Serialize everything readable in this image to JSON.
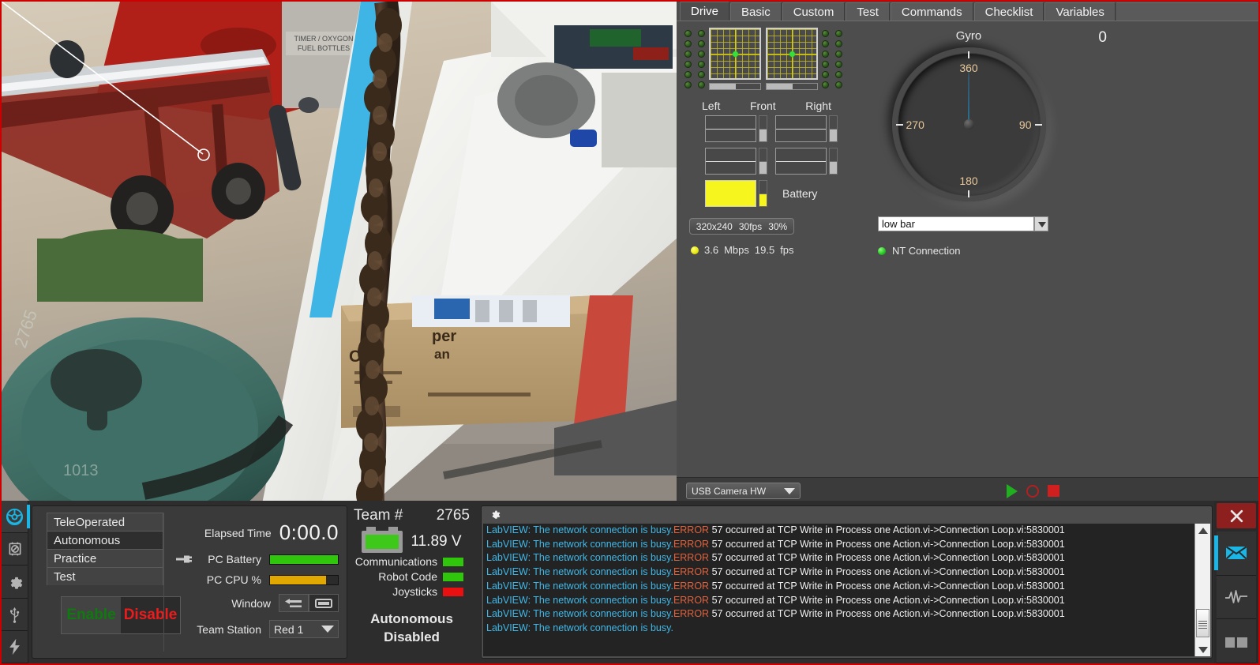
{
  "tabs": [
    {
      "label": "Drive",
      "active": true
    },
    {
      "label": "Basic",
      "active": false
    },
    {
      "label": "Custom",
      "active": false
    },
    {
      "label": "Test",
      "active": false
    },
    {
      "label": "Commands",
      "active": false
    },
    {
      "label": "Checklist",
      "active": false
    },
    {
      "label": "Variables",
      "active": false
    }
  ],
  "joystick": {
    "axis_labels": {
      "left": "Left",
      "front": "Front",
      "right": "Right"
    },
    "battery_label": "Battery"
  },
  "camera_info": {
    "resolution": "320x240",
    "fps": "30fps",
    "quality": "30%"
  },
  "stream_stats": {
    "bandwidth": "3.6",
    "bandwidth_unit": "Mbps",
    "fps": "19.5",
    "fps_unit": "fps"
  },
  "gyro": {
    "title": "Gyro",
    "value": "0",
    "ticks": [
      "360",
      "90",
      "180",
      "270"
    ],
    "needle_deg": 0,
    "needle_color": "#1f93d4"
  },
  "nt": {
    "field_value": "low bar",
    "status_label": "NT Connection"
  },
  "camera_source": {
    "label": "USB Camera HW"
  },
  "recorder": {
    "play": "play-icon",
    "record": "record-icon",
    "stop": "stop-icon"
  },
  "sidebar_left": [
    {
      "name": "operation-icon",
      "active": true
    },
    {
      "name": "diagnostics-icon",
      "active": false
    },
    {
      "name": "setup-gear-icon",
      "active": false
    },
    {
      "name": "usb-devices-icon",
      "active": false
    },
    {
      "name": "power-icon",
      "active": false
    }
  ],
  "sidebar_right": [
    {
      "name": "messages-icon",
      "active": true
    },
    {
      "name": "charts-icon",
      "active": false
    },
    {
      "name": "layout-icon",
      "active": false
    }
  ],
  "close_button": "close-icon",
  "control": {
    "modes": [
      {
        "label": "TeleOperated",
        "selected": false
      },
      {
        "label": "Autonomous",
        "selected": true
      },
      {
        "label": "Practice",
        "selected": false
      },
      {
        "label": "Test",
        "selected": false
      }
    ],
    "enable": "Enable",
    "disable": "Disable"
  },
  "stats": {
    "elapsed_label": "Elapsed Time",
    "elapsed_value": "0:00.0",
    "pc_battery_label": "PC Battery",
    "pc_battery_pct": 100,
    "pc_battery_color": "#2fc60c",
    "pc_cpu_label": "PC CPU %",
    "pc_cpu_pct": 82,
    "pc_cpu_color": "#e0a800",
    "window_label": "Window",
    "team_station_label": "Team Station",
    "team_station_value": "Red 1"
  },
  "robot": {
    "team_label": "Team #",
    "team_number": "2765",
    "voltage": "11.89 V",
    "indicators": [
      {
        "label": "Communications",
        "color": "#2fc60c"
      },
      {
        "label": "Robot Code",
        "color": "#2fc60c"
      },
      {
        "label": "Joysticks",
        "color": "#e81010"
      }
    ],
    "state_line1": "Autonomous",
    "state_line2": "Disabled"
  },
  "log": {
    "gear_icon": "gear-icon",
    "lines": [
      {
        "prefix": "LabVIEW: ",
        "msg": "The network connection is busy.",
        "err": "ERROR",
        "rest": " 57 occurred at TCP Write in Process one Action.vi->Connection Loop.vi:5830001"
      },
      {
        "prefix": "LabVIEW: ",
        "msg": "The network connection is busy.",
        "err": "ERROR",
        "rest": " 57 occurred at TCP Write in Process one Action.vi->Connection Loop.vi:5830001"
      },
      {
        "prefix": "LabVIEW: ",
        "msg": "The network connection is busy.",
        "err": "ERROR",
        "rest": " 57 occurred at TCP Write in Process one Action.vi->Connection Loop.vi:5830001"
      },
      {
        "prefix": "LabVIEW: ",
        "msg": "The network connection is busy.",
        "err": "ERROR",
        "rest": " 57 occurred at TCP Write in Process one Action.vi->Connection Loop.vi:5830001"
      },
      {
        "prefix": "LabVIEW: ",
        "msg": "The network connection is busy.",
        "err": "ERROR",
        "rest": " 57 occurred at TCP Write in Process one Action.vi->Connection Loop.vi:5830001"
      },
      {
        "prefix": "LabVIEW: ",
        "msg": "The network connection is busy.",
        "err": "ERROR",
        "rest": " 57 occurred at TCP Write in Process one Action.vi->Connection Loop.vi:5830001"
      },
      {
        "prefix": "LabVIEW: ",
        "msg": "The network connection is busy.",
        "err": "ERROR",
        "rest": " 57 occurred at TCP Write in Process one Action.vi->Connection Loop.vi:5830001"
      },
      {
        "prefix": "LabVIEW: ",
        "msg": "The network connection is busy.",
        "err": "",
        "rest": ""
      }
    ]
  },
  "camera_overlay": {
    "line_color": "#ffffff",
    "target_marker": "circle-marker"
  }
}
